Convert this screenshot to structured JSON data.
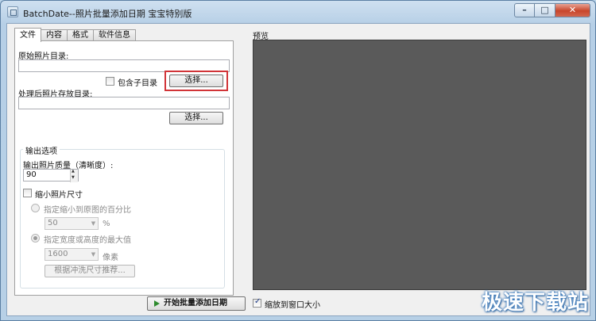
{
  "window": {
    "title": "BatchDate--照片批量添加日期 宝宝特别版",
    "caption": {
      "minimize": "–",
      "maximize": "□",
      "close": "✕"
    }
  },
  "tabs": [
    {
      "label": "文件",
      "active": true
    },
    {
      "label": "内容",
      "active": false
    },
    {
      "label": "格式",
      "active": false
    },
    {
      "label": "软件信息",
      "active": false
    }
  ],
  "file_tab": {
    "source_dir_label": "原始照片目录:",
    "source_dir_value": "",
    "include_subdirs_label": "包含子目录",
    "include_subdirs_checked": false,
    "source_browse_label": "选择...",
    "output_dir_label": "处理后照片存放目录:",
    "output_dir_value": "",
    "output_browse_label": "选择...",
    "output_options": {
      "title": "输出选项",
      "quality_label": "输出照片质量（清晰度）:",
      "quality_value": "90",
      "shrink_label": "缩小照片尺寸",
      "shrink_checked": false,
      "percent_label": "指定缩小到原图的百分比",
      "percent_value": "50",
      "percent_unit": "%",
      "maxsize_label": "指定宽度或高度的最大值",
      "maxsize_value": "1600",
      "maxsize_unit": "像素",
      "recommend_label": "根据冲洗尺寸推荐..."
    }
  },
  "preview": {
    "label": "预览",
    "fit_label": "缩放到窗口大小",
    "fit_checked": true
  },
  "start_button_label": "开始批量添加日期",
  "watermark_text": "极速下载站",
  "colors": {
    "preview_bg": "#5a5a5a",
    "highlight": "#d13438",
    "start_icon": "#2e8b2e"
  }
}
